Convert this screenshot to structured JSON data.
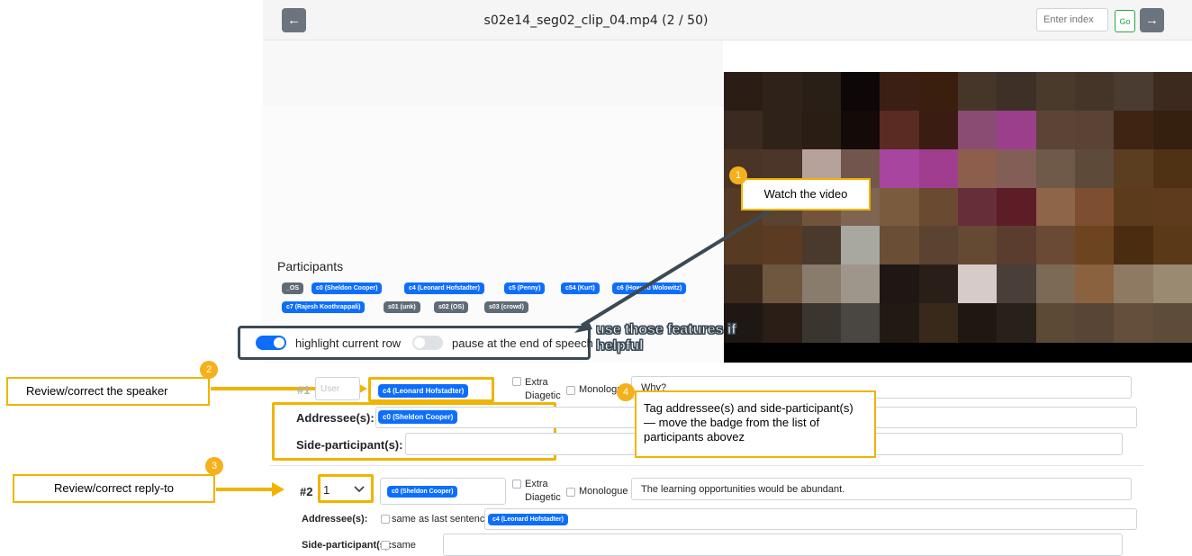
{
  "header": {
    "prev_icon": "←",
    "next_icon": "→",
    "title": "s02e14_seg02_clip_04.mp4 (2 / 50)",
    "index_placeholder": "Enter index",
    "go_label": "Go"
  },
  "participants": {
    "title": "Participants",
    "badges": [
      "_OS",
      "c0 (Sheldon Cooper)",
      "c4 (Leonard Hofstadter)",
      "c5 (Penny)",
      "c54 (Kurt)",
      "c6 (Howard Wolowitz)",
      "c7 (Rajesh Koothrappali)",
      "s01 (unk)",
      "s02 (OS)",
      "s03 (crowd)"
    ]
  },
  "toggles": {
    "highlight_label": "highlight current row",
    "highlight_on": true,
    "pause_label": "pause at the end of speech",
    "pause_on": false
  },
  "annotations": {
    "n1": "1",
    "watch": "Watch the video",
    "features": "use those features if helpful",
    "n2": "2",
    "speaker": "Review/correct the speaker",
    "n3": "3",
    "reply": "Review/correct reply-to",
    "n4": "4",
    "tag": "Tag addressee(s) and side-participant(s) — move the badge from the list of participants abovez"
  },
  "rows": [
    {
      "id": "#1",
      "reply_value": "User",
      "speaker": "c4 (Leonard Hofstadter)",
      "extra_diagetic": "Extra Diagetic",
      "monologue": "Monologue",
      "text": "Why?",
      "addressee_label": "Addressee(s):",
      "addressee_badge": "c0 (Sheldon Cooper)",
      "side_label": "Side-participant(s):"
    },
    {
      "id": "#2",
      "reply_value": "1",
      "speaker": "c0 (Sheldon Cooper)",
      "extra_diagetic": "Extra Diagetic",
      "monologue": "Monologue",
      "text": "The learning opportunities would be abundant.",
      "addressee_label": "Addressee(s):",
      "same_as_last": "same as last sentence",
      "addressee_badge": "c4 (Leonard Hofstadter)",
      "side_label": "Side-participant(s):",
      "same": "same"
    }
  ],
  "colors": {
    "accent": "#0d6efd",
    "callout": "#f0b400",
    "badge_gray": "#5f6b75"
  }
}
